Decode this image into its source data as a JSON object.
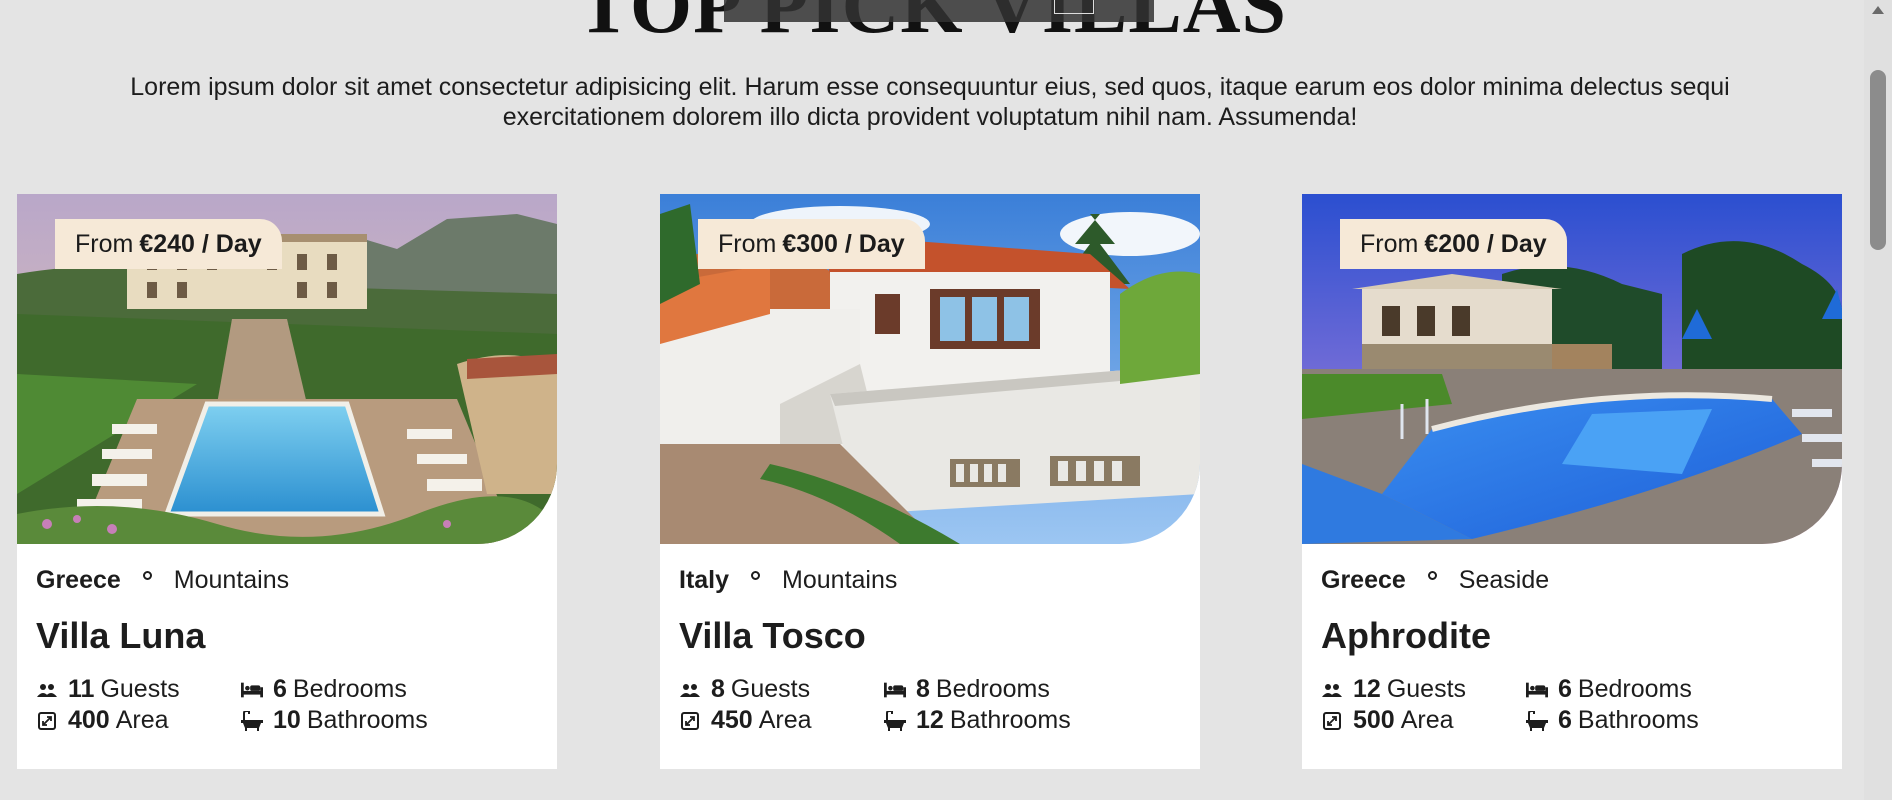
{
  "header": {
    "title": "TOP PICK VILLAS",
    "intro": "Lorem ipsum dolor sit amet consectetur adipisicing elit. Harum esse consequuntur eius, sed quos, itaque earum eos dolor minima delectus sequi exercitationem dolorem illo dicta provident voluptatum nihil nam. Assumenda!"
  },
  "cards": [
    {
      "price_prefix": "From",
      "price": "€240 / Day",
      "country": "Greece",
      "type": "Mountains",
      "name": "Villa Luna",
      "guests_value": "11",
      "guests_label": "Guests",
      "bedrooms_value": "6",
      "bedrooms_label": "Bedrooms",
      "area_value": "400",
      "area_label": "Area",
      "bathrooms_value": "10",
      "bathrooms_label": "Bathrooms"
    },
    {
      "price_prefix": "From",
      "price": "€300 / Day",
      "country": "Italy",
      "type": "Mountains",
      "name": "Villa Tosco",
      "guests_value": "8",
      "guests_label": "Guests",
      "bedrooms_value": "8",
      "bedrooms_label": "Bedrooms",
      "area_value": "450",
      "area_label": "Area",
      "bathrooms_value": "12",
      "bathrooms_label": "Bathrooms"
    },
    {
      "price_prefix": "From",
      "price": "€200 / Day",
      "country": "Greece",
      "type": "Seaside",
      "name": "Aphrodite",
      "guests_value": "12",
      "guests_label": "Guests",
      "bedrooms_value": "6",
      "bedrooms_label": "Bedrooms",
      "area_value": "500",
      "area_label": "Area",
      "bathrooms_value": "6",
      "bathrooms_label": "Bathrooms"
    }
  ],
  "icons": {
    "guests": "users-icon",
    "bedrooms": "bed-icon",
    "area": "area-icon",
    "bathrooms": "bathtub-icon"
  },
  "colors": {
    "page_background": "#e4e4e4",
    "card_background": "#ffffff",
    "price_badge": "#f6e9d7",
    "text": "#1d1d1d"
  }
}
